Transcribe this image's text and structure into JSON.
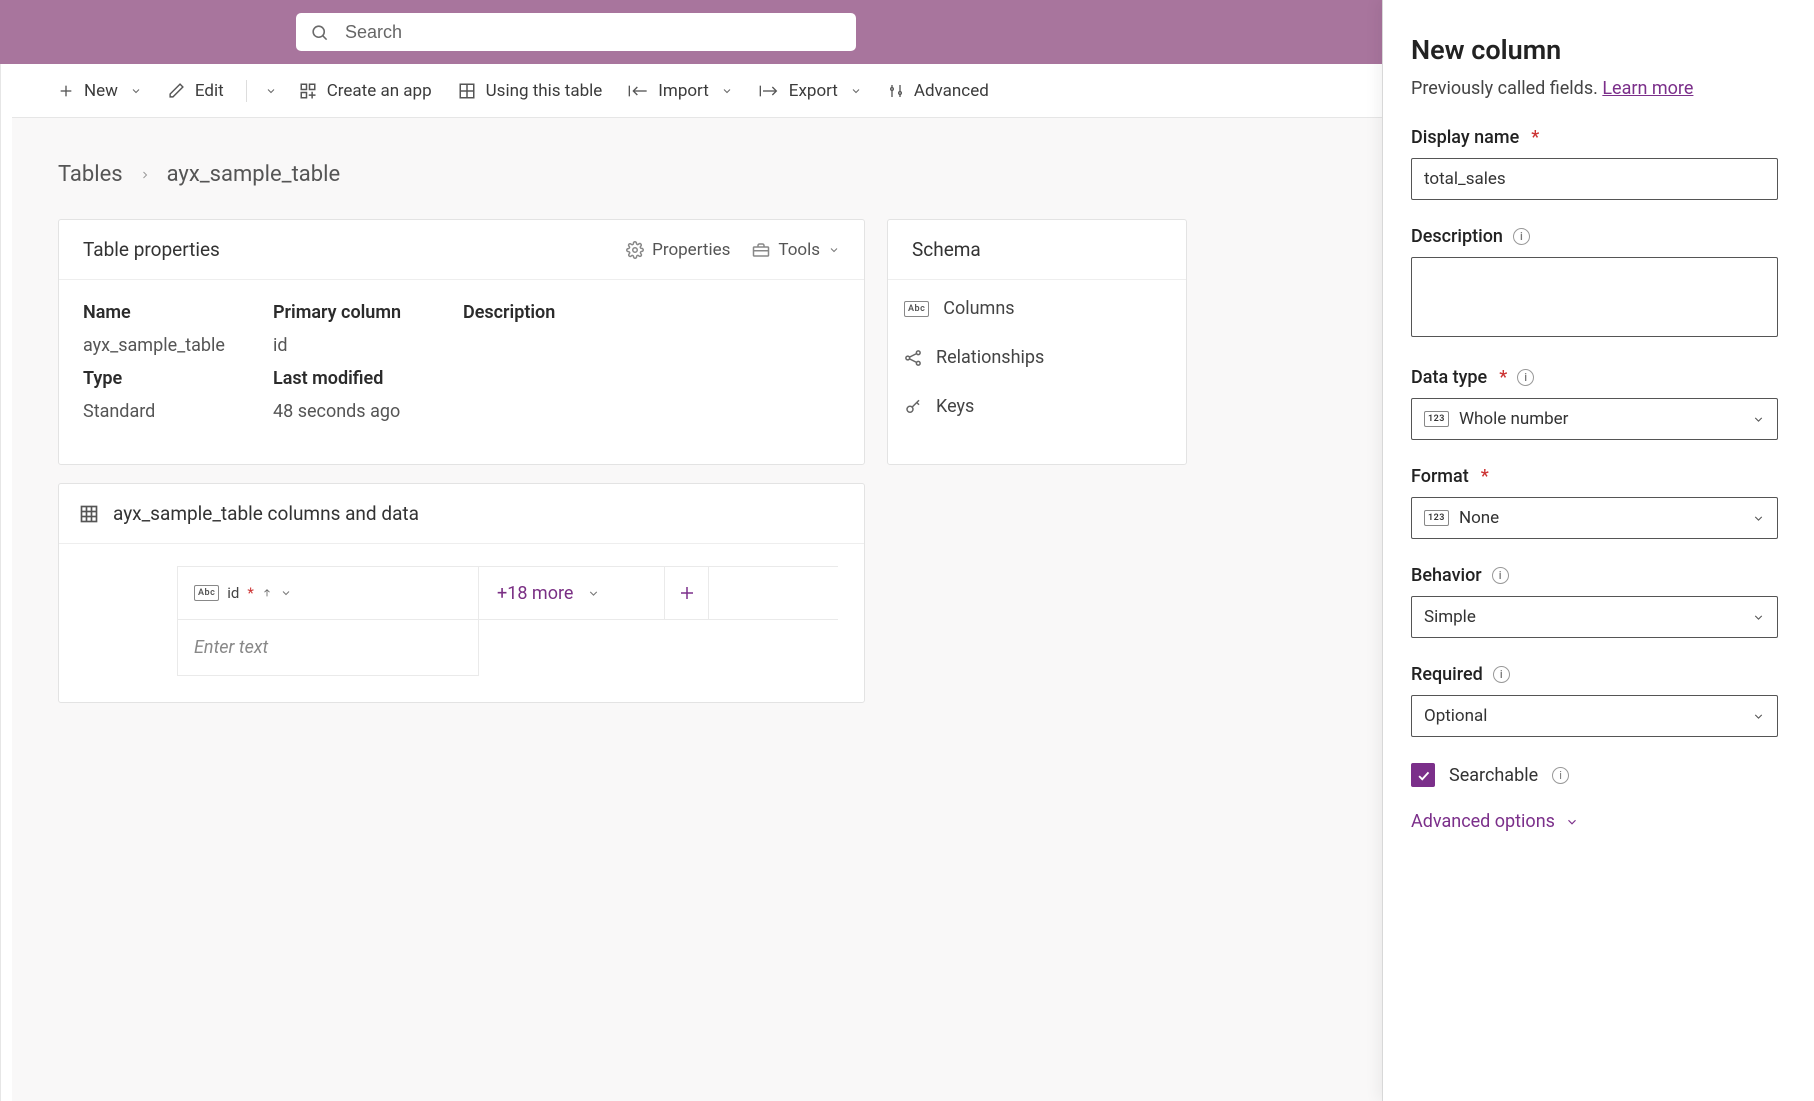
{
  "header": {
    "search_placeholder": "Search"
  },
  "cmdbar": {
    "new": "New",
    "edit": "Edit",
    "create_app": "Create an app",
    "using_table": "Using this table",
    "import": "Import",
    "export": "Export",
    "advanced": "Advanced"
  },
  "breadcrumb": {
    "root": "Tables",
    "current": "ayx_sample_table"
  },
  "props_card": {
    "title": "Table properties",
    "properties_label": "Properties",
    "tools_label": "Tools",
    "labels": {
      "name": "Name",
      "primary": "Primary column",
      "description": "Description",
      "type": "Type",
      "last_modified": "Last modified"
    },
    "values": {
      "name": "ayx_sample_table",
      "primary": "id",
      "type": "Standard",
      "last_modified": "48 seconds ago"
    }
  },
  "schema_card": {
    "title": "Schema",
    "items": [
      "Columns",
      "Relationships",
      "Keys"
    ]
  },
  "cols_card": {
    "title": "ayx_sample_table columns and data",
    "col": {
      "name": "id",
      "star": "*"
    },
    "more": "+18 more",
    "placeholder": "Enter text"
  },
  "panel": {
    "title": "New column",
    "subtitle_prefix": "Previously called fields. ",
    "learn_more": "Learn more",
    "display_name_label": "Display name",
    "display_name_value": "total_sales",
    "description_label": "Description",
    "description_value": "",
    "data_type_label": "Data type",
    "data_type_value": "Whole number",
    "format_label": "Format",
    "format_value": "None",
    "behavior_label": "Behavior",
    "behavior_value": "Simple",
    "required_label": "Required",
    "required_value": "Optional",
    "searchable_label": "Searchable",
    "searchable_checked": true,
    "advanced_options": "Advanced options"
  }
}
